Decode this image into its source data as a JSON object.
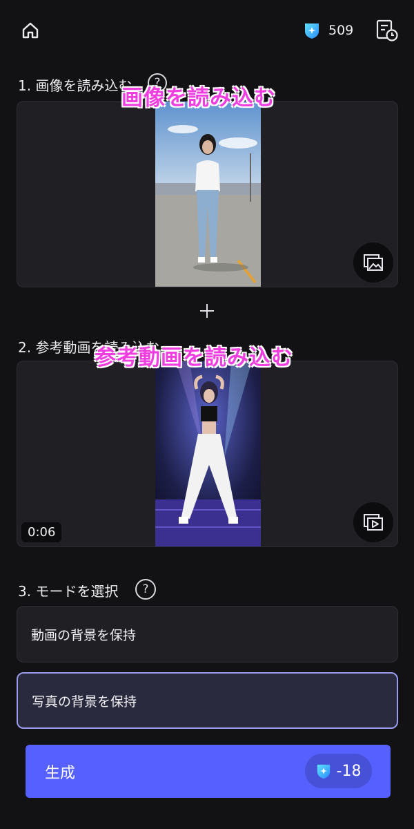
{
  "header": {
    "credits": "509",
    "home_icon": "home-icon",
    "gem_icon": "gem-icon",
    "history_icon": "history-icon"
  },
  "step1": {
    "label": "1. 画像を読み込む",
    "overlay": "画像を読み込む",
    "image_desc": "photo",
    "action_icon": "image-replace-icon"
  },
  "step2": {
    "label": "2. 参考動画を読み込む",
    "overlay": "参考動画を読み込む",
    "duration": "0:06",
    "action_icon": "video-replace-icon"
  },
  "plus_icon": "plus-icon",
  "step3": {
    "label": "3. モードを選択",
    "help": "?",
    "options": [
      {
        "label": "動画の背景を保持",
        "selected": false
      },
      {
        "label": "写真の背景を保持",
        "selected": true
      }
    ]
  },
  "generate": {
    "label": "生成",
    "cost": "-18"
  },
  "colors": {
    "background": "#121214",
    "card": "#1f1f24",
    "accent": "#5560ff",
    "selected_border": "#9b9bf0",
    "overlay_text": "#ee3ee0",
    "gem": "#35c4ff"
  }
}
